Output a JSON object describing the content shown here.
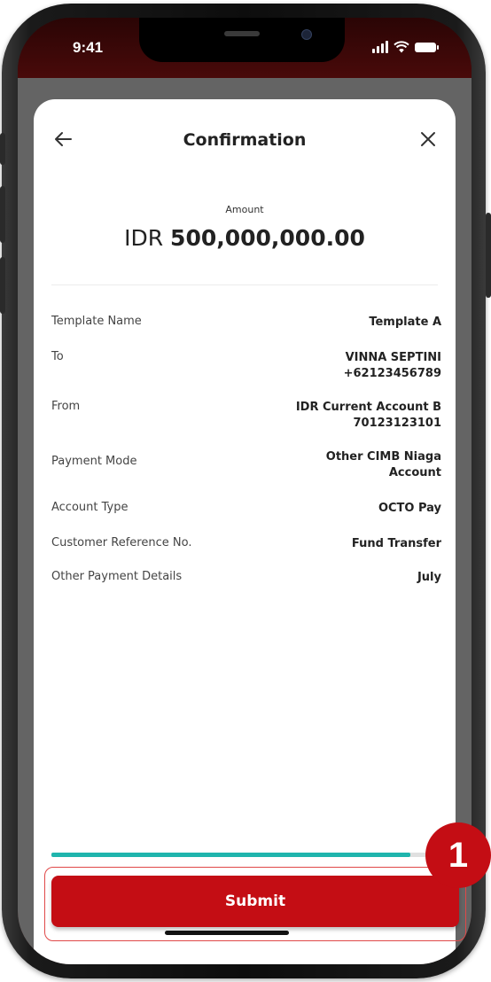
{
  "status_bar": {
    "time": "9:41"
  },
  "header": {
    "title": "Confirmation",
    "back_icon": "arrow-left-icon",
    "close_icon": "close-icon"
  },
  "amount": {
    "label": "Amount",
    "currency": "IDR",
    "value": "500,000,000.00"
  },
  "details": [
    {
      "label": "Template Name",
      "value": "Template A"
    },
    {
      "label": "To",
      "value": "VINNA SEPTINI\n+62123456789"
    },
    {
      "label": "From",
      "value": "IDR Current Account B\n70123123101"
    },
    {
      "label": "Payment Mode",
      "value": "Other CIMB Niaga\nAccount"
    },
    {
      "label": "Account Type",
      "value": "OCTO Pay"
    },
    {
      "label": "Customer Reference No.",
      "value": "Fund Transfer"
    },
    {
      "label": "Other Payment Details",
      "value": "July"
    }
  ],
  "progress": {
    "fraction": 0.92,
    "color": "#1fb5ad"
  },
  "submit_button": {
    "label": "Submit",
    "color": "#c40d14"
  },
  "step_badge": {
    "number": "1"
  }
}
